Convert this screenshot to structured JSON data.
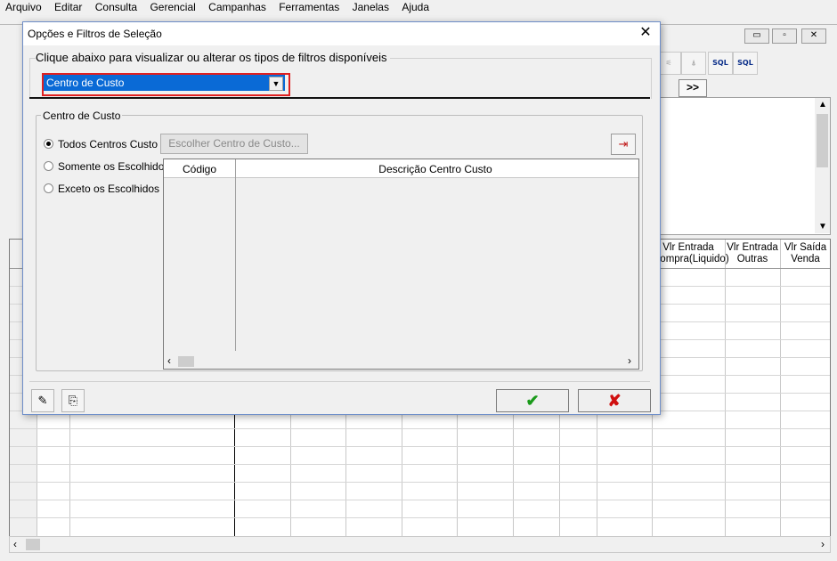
{
  "menu": [
    "Arquivo",
    "Editar",
    "Consulta",
    "Gerencial",
    "Campanhas",
    "Ferramentas",
    "Janelas",
    "Ajuda"
  ],
  "background": {
    "toolbar": {
      "sql_label": "SQL"
    },
    "nav_button": ">>",
    "grid_headers": [
      {
        "line1": "Vlr Entrada",
        "line2": "Compra(Liquido)"
      },
      {
        "line1": "Vlr Entrada",
        "line2": "Outras"
      },
      {
        "line1": "Vlr Saída",
        "line2": "Venda"
      }
    ]
  },
  "dialog": {
    "title": "Opções e Filtros de Seleção",
    "hint": "Clique abaixo para visualizar ou alterar os tipos de filtros disponíveis",
    "filter_type": "Centro de Custo",
    "group_label": "Centro de Custo",
    "radios": [
      {
        "label": "Todos Centros Custo",
        "checked": true
      },
      {
        "label": "Somente os Escolhidos",
        "checked": false
      },
      {
        "label": "Exceto os Escolhidos",
        "checked": false
      }
    ],
    "choose_button": "Escolher Centro de Custo...",
    "table": {
      "col_code": "Código",
      "col_desc": "Descrição Centro Custo"
    },
    "ok_icon": "check-icon",
    "cancel_icon": "x-icon"
  },
  "colors": {
    "selection": "#0a6ad6",
    "highlight_border": "#e02020",
    "ok": "#1a9a1a",
    "cancel": "#d01010"
  }
}
